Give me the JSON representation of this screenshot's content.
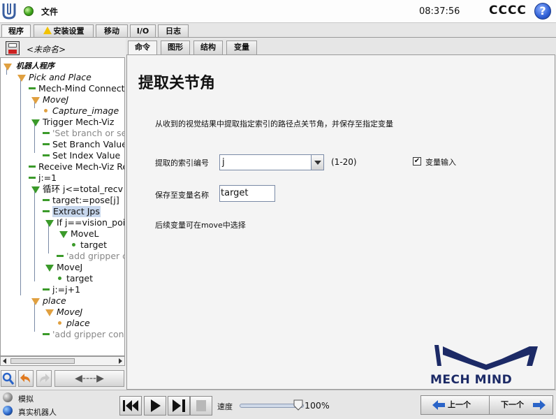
{
  "topbar": {
    "menu_file": "文件",
    "clock": "08:37:56",
    "robot_name": "CCCC",
    "help": "?"
  },
  "main_tabs": [
    "程序",
    "安装设置",
    "移动",
    "I/O",
    "日志"
  ],
  "left": {
    "program_name": "<未命名>",
    "tree": [
      "机器人程序",
      "Pick and Place",
      "Mech-Mind Connect",
      "MoveJ",
      "Capture_image",
      "Trigger Mech-Viz",
      "'Set branch or se",
      "Set Branch Value",
      "Set Index Value",
      "Receive Mech-Viz Re",
      "j:=1",
      "循环 j<=total_recv",
      "target:=pose[j]",
      "Extract Jps",
      "If j==vision_poin",
      "MoveL",
      "target",
      "'add gripper c",
      "MoveJ",
      "target",
      "j:=j+1",
      "place",
      "MoveJ",
      "place",
      "'add gripper con"
    ],
    "nav_arrows": "◀----▶"
  },
  "sub_tabs": [
    "命令",
    "图形",
    "结构",
    "变量"
  ],
  "content": {
    "title": "提取关节角",
    "description": "从收到的视觉结果中提取指定索引的路径点关节角，并保存至指定变量",
    "index_label": "提取的索引编号",
    "index_value": "j",
    "index_range": "(1-20)",
    "var_input_checked": "✔",
    "var_input_label": "变量输入",
    "save_label": "保存至变量名称",
    "save_value": "target",
    "note": "后续变量可在move中选择",
    "logo_text": "MECH MIND"
  },
  "bottom": {
    "simulate": "模拟",
    "real_robot": "真实机器人",
    "speed_label": "速度",
    "speed_value": "100%",
    "prev": "上一个",
    "next": "下一个"
  },
  "colors": {
    "accent_blue": "#1c2a66",
    "node_green": "#3b9a2a",
    "node_orange": "#e0a040",
    "selection": "#c6d6ec"
  }
}
